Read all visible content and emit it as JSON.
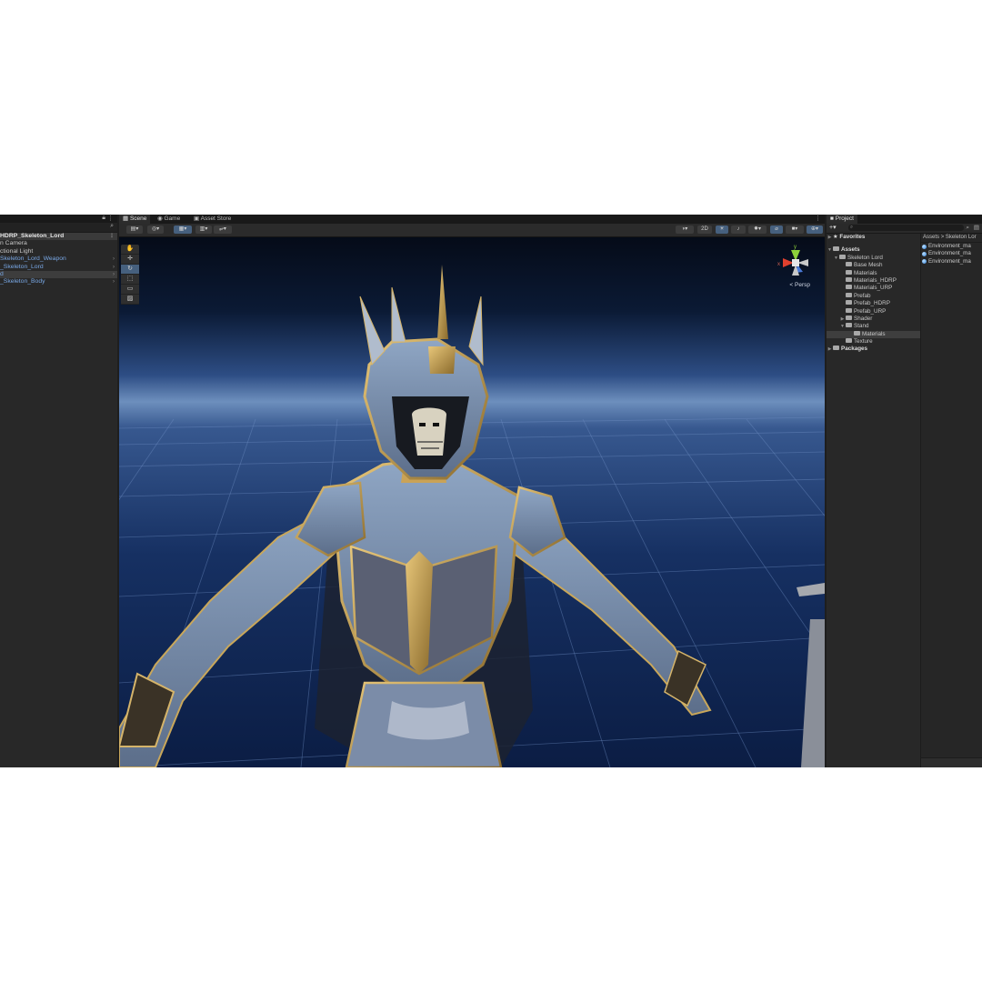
{
  "hierarchy": {
    "items": [
      {
        "label": "HDRP_Skeleton_Lord"
      },
      {
        "label": "n Camera"
      },
      {
        "label": "ctional Light"
      },
      {
        "label": "Skeleton_Lord_Weapon"
      },
      {
        "label": "_Skeleton_Lord"
      },
      {
        "label": "d"
      },
      {
        "label": "_Skeleton_Body"
      }
    ]
  },
  "scene": {
    "tabs": [
      {
        "label": "Scene"
      },
      {
        "label": "Game"
      },
      {
        "label": "Asset Store"
      }
    ],
    "toolbar": {
      "mode_2d": "2D"
    },
    "persp_label": "Persp",
    "gizmo": {
      "x_label": "x",
      "y_label": "y",
      "axis_x_color": "#e0402e",
      "axis_y_color": "#8cd03a",
      "axis_z_color": "#4a7ad8"
    }
  },
  "project": {
    "tab_label": "Project",
    "favorites_label": "Favorites",
    "assets_label": "Assets",
    "folders": [
      {
        "label": "Skeleton Lord"
      },
      {
        "label": "Base Mesh"
      },
      {
        "label": "Materials"
      },
      {
        "label": "Materials_HDRP"
      },
      {
        "label": "Materials_URP"
      },
      {
        "label": "Prefab"
      },
      {
        "label": "Prefab_HDRP"
      },
      {
        "label": "Prefab_URP"
      },
      {
        "label": "Shader"
      },
      {
        "label": "Stand"
      },
      {
        "label": "Materials"
      },
      {
        "label": "Texture"
      }
    ],
    "packages_label": "Packages",
    "breadcrumb": {
      "root": "Assets",
      "separator": ">",
      "current": "Skeleton Lor"
    },
    "files": [
      {
        "label": "Environment_ma"
      },
      {
        "label": "Environment_ma"
      },
      {
        "label": "Environment_ma"
      }
    ]
  },
  "colors": {
    "accent": "#46607e",
    "hierarchy_link": "#79a8e6"
  }
}
